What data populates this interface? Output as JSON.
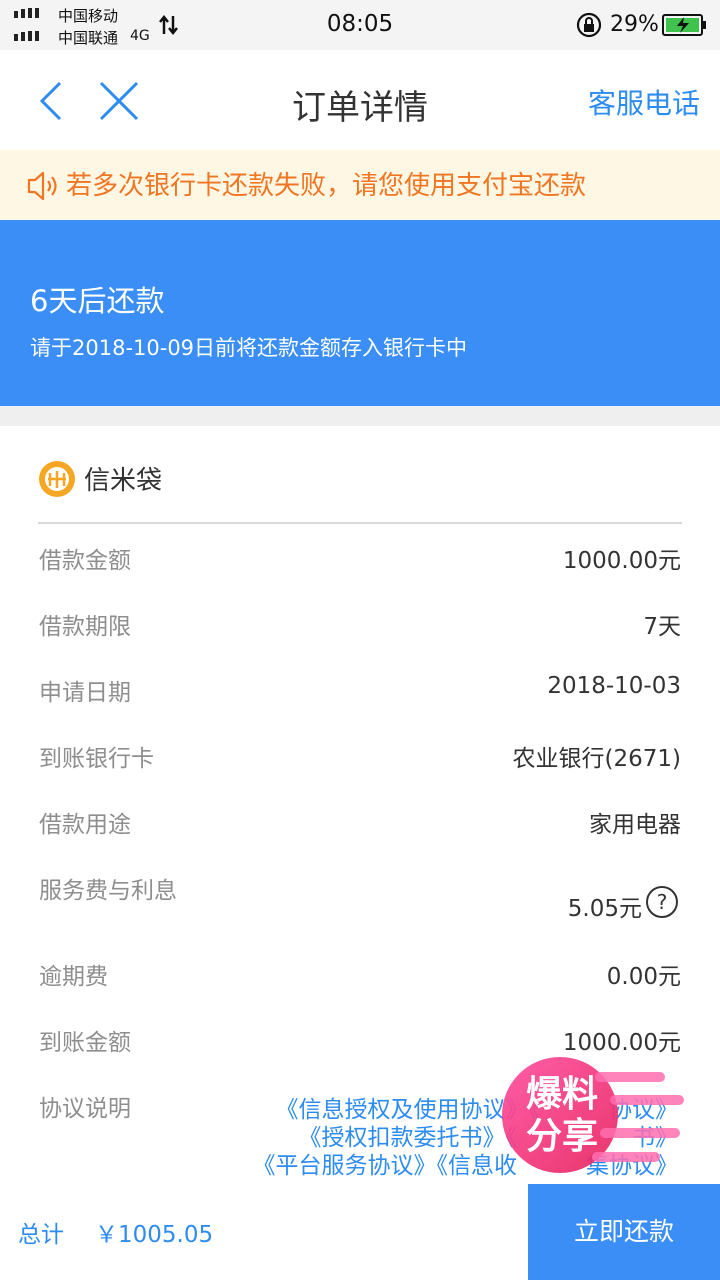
{
  "status_bar": {
    "carrier1": "中国移动",
    "carrier2": "中国联通",
    "network": "4G",
    "time": "08:05",
    "battery": "29%"
  },
  "nav": {
    "title": "订单详情",
    "right_label": "客服电话"
  },
  "notice": {
    "text": "若多次银行卡还款失败，请您使用支付宝还款"
  },
  "banner": {
    "title": "6天后还款",
    "subtitle": "请于2018-10-09日前将还款金额存入银行卡中",
    "color": "#3a8ef5"
  },
  "brand": {
    "name": "信米袋"
  },
  "details": [
    {
      "label": "借款金额",
      "value": "1000.00元"
    },
    {
      "label": "借款期限",
      "value": "7天"
    },
    {
      "label": "申请日期",
      "value": "2018-10-03"
    },
    {
      "label": "到账银行卡",
      "value": "农业银行(2671)"
    },
    {
      "label": "借款用途",
      "value": "家用电器"
    },
    {
      "label": "服务费与利息",
      "value": "5.05元"
    },
    {
      "label": "逾期费",
      "value": "0.00元"
    },
    {
      "label": "到账金额",
      "value": "1000.00元"
    }
  ],
  "agreements": {
    "label": "协议说明",
    "lines": [
      "《信息授权及使用协议》《　　　协议》",
      "《授权扣款委托书》《　　　　　书》",
      "《平台服务协议》《信息收　　　集协议》"
    ]
  },
  "watermark": {
    "line1": "爆料",
    "line2": "分享"
  },
  "footer": {
    "total_label": "总计",
    "total_value": "￥1005.05",
    "pay_button": "立即还款"
  },
  "colors": {
    "accent": "#2d8cf0",
    "notice_text": "#f07623",
    "notice_bg": "#fdf7e3"
  }
}
